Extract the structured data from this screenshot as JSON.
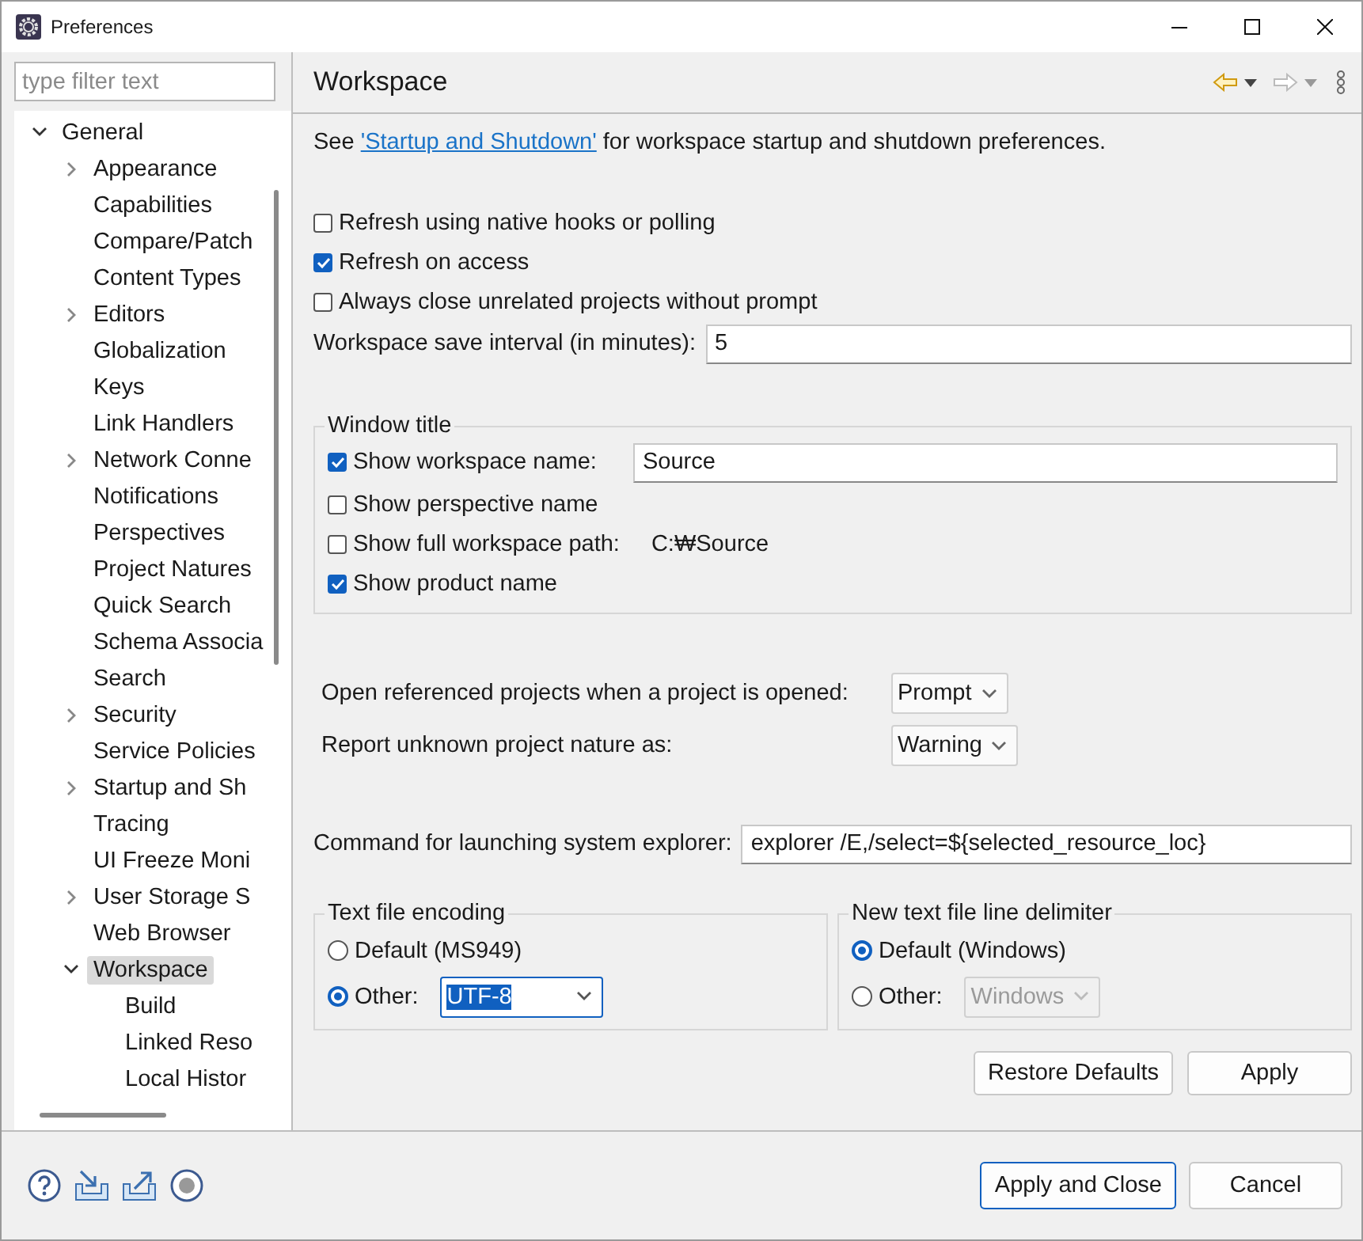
{
  "window": {
    "title": "Preferences"
  },
  "sidebar": {
    "filter": {
      "placeholder": "type filter text"
    },
    "tree": [
      {
        "label": "General",
        "expanded": true,
        "selected": false,
        "children": [
          {
            "label": "Appearance",
            "expanded": false,
            "selected": false
          },
          {
            "label": "Capabilities",
            "selected": false
          },
          {
            "label": "Compare/Patch",
            "selected": false
          },
          {
            "label": "Content Types",
            "selected": false
          },
          {
            "label": "Editors",
            "expanded": false,
            "selected": false
          },
          {
            "label": "Globalization",
            "selected": false
          },
          {
            "label": "Keys",
            "selected": false
          },
          {
            "label": "Link Handlers",
            "selected": false
          },
          {
            "label": "Network Conne",
            "expanded": false,
            "selected": false
          },
          {
            "label": "Notifications",
            "selected": false
          },
          {
            "label": "Perspectives",
            "selected": false
          },
          {
            "label": "Project Natures",
            "selected": false
          },
          {
            "label": "Quick Search",
            "selected": false
          },
          {
            "label": "Schema Associa",
            "selected": false
          },
          {
            "label": "Search",
            "selected": false
          },
          {
            "label": "Security",
            "expanded": false,
            "selected": false
          },
          {
            "label": "Service Policies",
            "selected": false
          },
          {
            "label": "Startup and Sh",
            "expanded": false,
            "selected": false
          },
          {
            "label": "Tracing",
            "selected": false
          },
          {
            "label": "UI Freeze Moni",
            "selected": false
          },
          {
            "label": "User Storage S",
            "expanded": false,
            "selected": false
          },
          {
            "label": "Web Browser",
            "selected": false
          },
          {
            "label": "Workspace",
            "expanded": true,
            "selected": true,
            "children": [
              {
                "label": "Build",
                "selected": false
              },
              {
                "label": "Linked Reso",
                "selected": false
              },
              {
                "label": "Local Histor",
                "selected": false
              }
            ]
          }
        ]
      }
    ]
  },
  "page": {
    "title": "Workspace",
    "intro": {
      "before": "See ",
      "link": "'Startup and Shutdown'",
      "after": " for workspace startup and shutdown preferences."
    },
    "options": [
      {
        "label": "Refresh using native hooks or polling",
        "checked": false
      },
      {
        "label": "Refresh on access",
        "checked": true
      },
      {
        "label": "Always close unrelated projects without prompt",
        "checked": false
      }
    ],
    "save_interval": {
      "label": "Workspace save interval (in minutes):",
      "value": "5"
    },
    "window_title": {
      "title": "Window title",
      "options": [
        {
          "kind": "field",
          "label": "Show workspace name:",
          "checked": true,
          "value": "Source"
        },
        {
          "kind": "plain",
          "label": "Show perspective name",
          "checked": false
        },
        {
          "kind": "path",
          "label": "Show full workspace path:",
          "checked": false,
          "value": "C:₩Source"
        },
        {
          "kind": "plain",
          "label": "Show product name",
          "checked": true
        }
      ]
    },
    "combos": [
      {
        "label": "Open referenced projects when a project is opened:",
        "value": "Prompt"
      },
      {
        "label": "Report unknown project nature as:",
        "value": "Warning"
      }
    ],
    "explorer": {
      "label": "Command for launching system explorer:",
      "value": "explorer /E,/select=${selected_resource_loc}"
    },
    "groups": [
      {
        "title": "Text file encoding",
        "options": [
          {
            "label": "Default (MS949)",
            "selected": false
          },
          {
            "label": "Other:",
            "selected": true,
            "combo": "UTF-8",
            "disabled": false
          }
        ]
      },
      {
        "title": "New text file line delimiter",
        "options": [
          {
            "label": "Default (Windows)",
            "selected": true
          },
          {
            "label": "Other:",
            "selected": false,
            "combo": "Windows",
            "disabled": true
          }
        ]
      }
    ],
    "buttons": [
      "Restore Defaults",
      "Apply"
    ]
  },
  "footer": {
    "buttons": [
      "Apply and Close",
      "Cancel"
    ]
  }
}
